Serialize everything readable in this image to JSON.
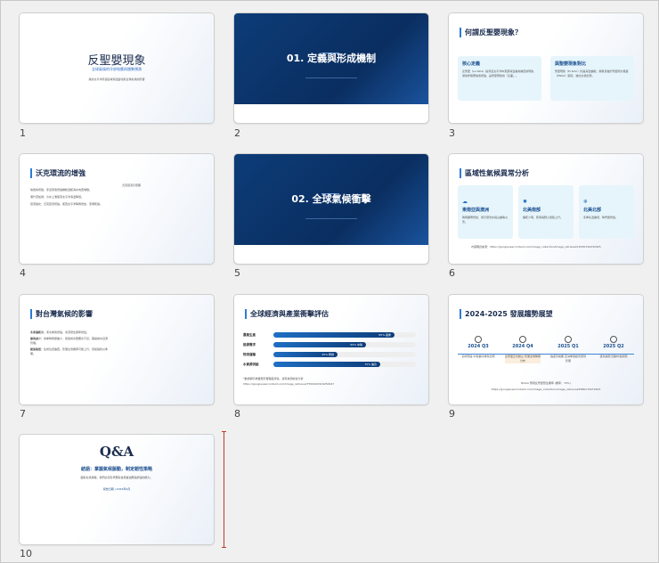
{
  "slides": [
    {
      "number": "1",
      "title": "反聖嬰現象",
      "subtitle": "全球氣候的冷卻效應與趨勢預測",
      "note": "探討太平洋赤道區域海溫變化對全球氣候的影響"
    },
    {
      "number": "2",
      "title": "01. 定義與形成機制"
    },
    {
      "number": "3",
      "title": "何謂反聖嬰現象？",
      "cards": [
        {
          "title": "核心定義",
          "text": "反聖嬰（La Niña）指赤道太平洋中東部海溫異常偏低的現象，通常伴隨著信風增強，是聖嬰現象的「反面」。"
        },
        {
          "title": "與聖嬰現象對比",
          "text": "聖嬰現象（El Niño）則是海溫偏暖，兩者皆屬於聖嬰南方振盪（ENSO）循環，彼此交替出現。"
        }
      ]
    },
    {
      "number": "4",
      "title": "沃克環流的增強",
      "items": [
        "信風的增強：赤道東風增強推動溫暖海水向西堆積。",
        "湧升流加劇：冷水上湧使東太平洋海溫降低。",
        "環流強化：沃克環流增強，使西太平洋降雨增加、東側乾燥。"
      ],
      "image_caption": "沃克環流示意圖"
    },
    {
      "number": "5",
      "title": "02. 全球氣候衝擊"
    },
    {
      "number": "6",
      "title": "區域性氣候異常分析",
      "cards": [
        {
          "icon": "cloud-rain",
          "title": "東南亞與澳洲",
          "text": "降雨顯著增加，易引發洪水與山崩等災害。"
        },
        {
          "icon": "sun",
          "title": "北美南部",
          "text": "偏乾少雨，乾旱與野火風險上升。"
        },
        {
          "icon": "snowflake",
          "title": "北美北部",
          "text": "冬季氣溫偏低，降雪量增加。"
        }
      ],
      "source": "內容圖資來源：https://googleusercontent.com/image_collection/image_retrieval/16530720232425"
    },
    {
      "number": "7",
      "title": "對台灣氣候的影響",
      "items": [
        {
          "label": "冬季偏乾冷：",
          "text": "東北季風增強，寒流發生頻率增加。"
        },
        {
          "label": "春雨減少：",
          "text": "春季降雨量偏少，易造成水庫蓄水不足，需提前水資源管理。"
        },
        {
          "label": "颱風路徑：",
          "text": "生成位置偏西，影響台灣機率可能上升，須加強防災準備。"
        }
      ]
    },
    {
      "number": "8",
      "title": "全球經濟與產業衝擊評估",
      "bars": [
        {
          "label": "農業生產",
          "value": 85,
          "text": "85% 嚴重"
        },
        {
          "label": "能源需求",
          "value": 65,
          "text": "65% 中等"
        },
        {
          "label": "物流運輸",
          "value": 45,
          "text": "45% 輕微"
        },
        {
          "label": "水資源供給",
          "value": 75,
          "text": "75% 偏高"
        }
      ],
      "source": "*數據顯示產業受影響程度評估，資料來源綜合分析",
      "url": "https://googleusercontent.com/image_retrieval/7563202324252627"
    },
    {
      "number": "9",
      "title": "2024-2025 發展趨勢展望",
      "milestones": [
        {
          "period": "2024 Q3",
          "text": "初步階段 中性偏冷條件出現"
        },
        {
          "period": "2024 Q4",
          "text": "反聖嬰正式確立 影響全球降雨分布"
        },
        {
          "period": "2025 Q1",
          "text": "強度高峰期 亞洲季風模式受到影響"
        },
        {
          "period": "2025 Q2",
          "text": "逐漸減弱 回歸中性狀態"
        }
      ],
      "source": "NOAA 預測反聖嬰發生機率 (機率：70%)",
      "url": "https://googleusercontent.com/image_collection/image_retrieval/4586179272425"
    },
    {
      "number": "10",
      "title": "Q&A",
      "subtitle": "結語：掌握氣候脈動，制定韌性策略",
      "text": "面對氣候挑戰，我們必須及早應對並培養適應與調適的能力。",
      "date": "報告日期 | 2024年9月"
    }
  ]
}
